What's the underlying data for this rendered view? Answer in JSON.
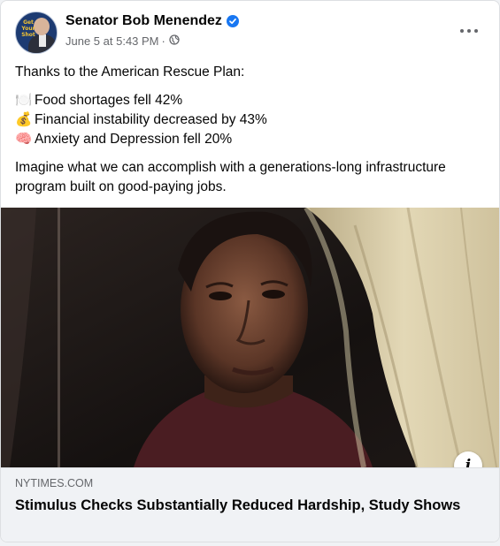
{
  "post": {
    "author": "Senator Bob Menendez",
    "timestamp": "June 5 at 5:43 PM",
    "separator": "·",
    "avatar_badge": "Get Your Shot",
    "text": {
      "intro": "Thanks to the American Rescue Plan:",
      "items": [
        {
          "emoji": "🍽️",
          "icon": "fork-knife-plate-icon",
          "label": "Food shortages fell 42%"
        },
        {
          "emoji": "💰",
          "icon": "money-bag-icon",
          "label": "Financial instability decreased by 43%"
        },
        {
          "emoji": "🧠",
          "icon": "brain-icon",
          "label": "Anxiety and Depression fell 20%"
        }
      ],
      "closing": "Imagine what we can accomplish with a generations-long infrastructure program built on good-paying jobs."
    }
  },
  "link": {
    "domain": "NYTIMES.COM",
    "headline": "Stimulus Checks Substantially Reduced Hardship, Study Shows"
  },
  "icons": {
    "verified": "verified-badge-icon",
    "privacy": "globe-icon",
    "more": "more-options-icon",
    "info": "info-icon"
  },
  "colors": {
    "verified_blue": "#1877f2",
    "secondary_text": "#65676b",
    "preview_bg": "#f0f2f5"
  }
}
